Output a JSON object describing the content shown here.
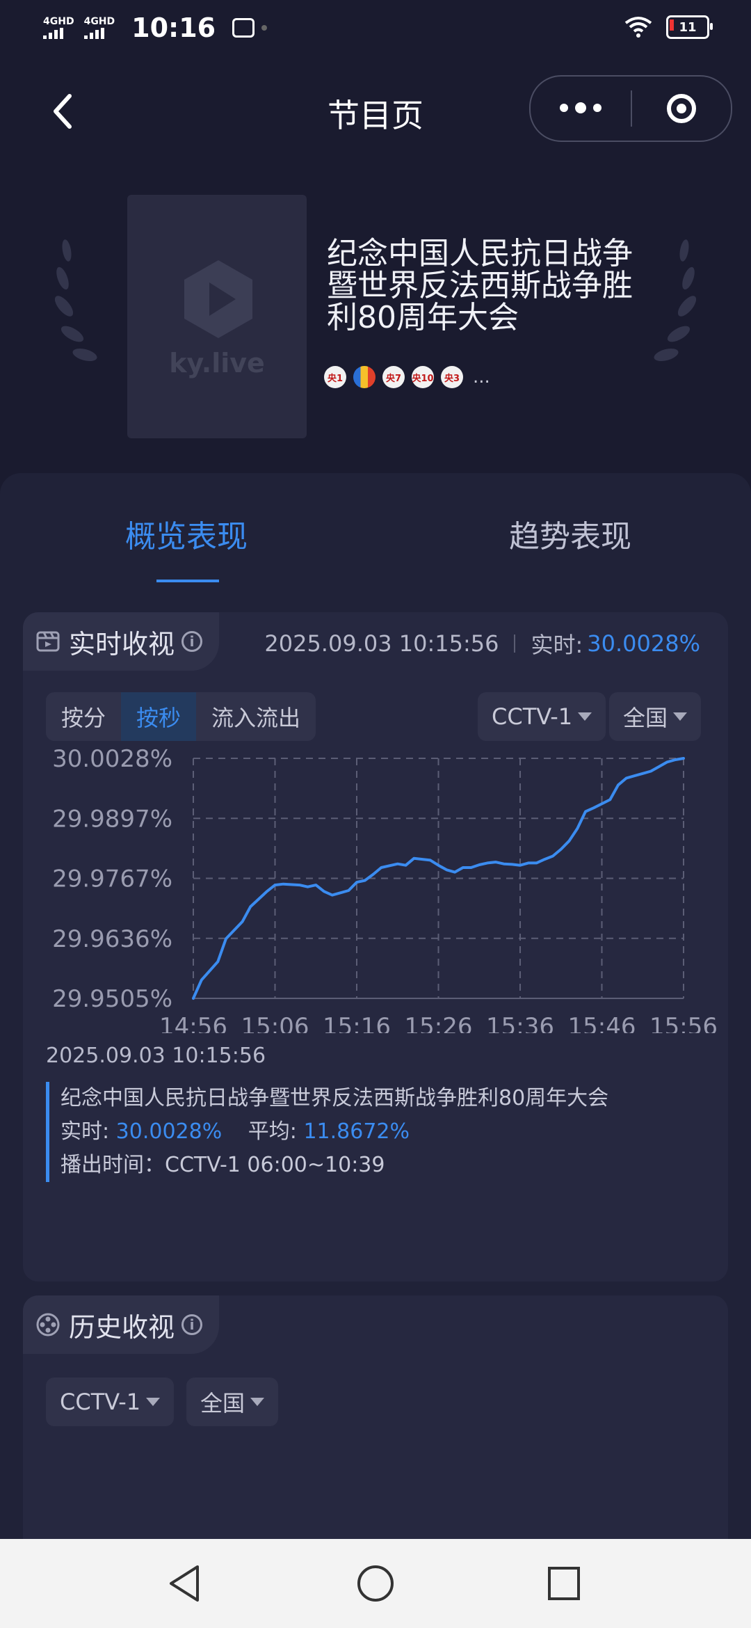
{
  "status_bar": {
    "net1": "4GHD",
    "net2": "4GHD",
    "time": "10:16",
    "battery": "11"
  },
  "nav": {
    "title": "节目页"
  },
  "program": {
    "poster_logo": "ky.live",
    "title": "纪念中国人民抗日战争暨世界反法西斯战争胜利80周年大会",
    "channels": [
      "央1",
      "",
      "央7",
      "央10",
      "央3"
    ],
    "more": "..."
  },
  "tabs": [
    {
      "label": "概览表现",
      "active": true
    },
    {
      "label": "趋势表现",
      "active": false
    }
  ],
  "realtime": {
    "title": "实时收视",
    "info": "i",
    "timestamp": "2025.09.03 10:15:56",
    "live_label": "实时:",
    "live_value": "30.0028%",
    "segments": [
      "按分",
      "按秒",
      "流入流出"
    ],
    "active_segment": "按秒",
    "channel": "CCTV-1",
    "region": "全国"
  },
  "chart_data": {
    "type": "line",
    "x_ticks": [
      "14:56",
      "15:06",
      "15:16",
      "15:26",
      "15:36",
      "15:46",
      "15:56"
    ],
    "y_ticks": [
      "30.0028%",
      "29.9897%",
      "29.9767%",
      "29.9636%",
      "29.9505%"
    ],
    "ylim": [
      29.9505,
      30.0028
    ],
    "grid": true,
    "series": [
      {
        "x_minutes": [
          0,
          1,
          3,
          4,
          6,
          7,
          9,
          10,
          11,
          13,
          14,
          15,
          16,
          17,
          18,
          19,
          20,
          21,
          22,
          23,
          25,
          26,
          27,
          29,
          30,
          31,
          32,
          33,
          34,
          35,
          36,
          37,
          38,
          39,
          40,
          41,
          42,
          43,
          44,
          45,
          46,
          47,
          48,
          49,
          51,
          52,
          53,
          54,
          55,
          56,
          57,
          58,
          59,
          60
        ],
        "values": [
          29.9505,
          29.9545,
          29.9585,
          29.9635,
          29.9672,
          29.9705,
          29.9738,
          29.9752,
          29.9754,
          29.9752,
          29.9748,
          29.9752,
          29.9738,
          29.973,
          29.9735,
          29.974,
          29.9758,
          29.9762,
          29.9775,
          29.979,
          29.9798,
          29.9795,
          29.981,
          29.9806,
          29.9795,
          29.9785,
          29.978,
          29.979,
          29.979,
          29.9796,
          29.98,
          29.9802,
          29.9798,
          29.9797,
          29.9795,
          29.98,
          29.98,
          29.9808,
          29.9815,
          29.983,
          29.9848,
          29.9875,
          29.9912,
          29.992,
          29.9938,
          29.997,
          29.9985,
          29.999,
          29.9995,
          30.0,
          30.001,
          30.002,
          30.0025,
          30.0028
        ]
      }
    ],
    "line_color": "#3b8cf0"
  },
  "readout": {
    "date": "2025.09.03 10:15:56",
    "name": "纪念中国人民抗日战争暨世界反法西斯战争胜利80周年大会",
    "live_label": "实时:",
    "live_value": "30.0028%",
    "avg_label": "平均:",
    "avg_value": "11.8672%",
    "airtime": "播出时间：CCTV-1 06:00~10:39"
  },
  "history": {
    "title": "历史收视",
    "info": "i",
    "channel": "CCTV-1",
    "region": "全国"
  }
}
